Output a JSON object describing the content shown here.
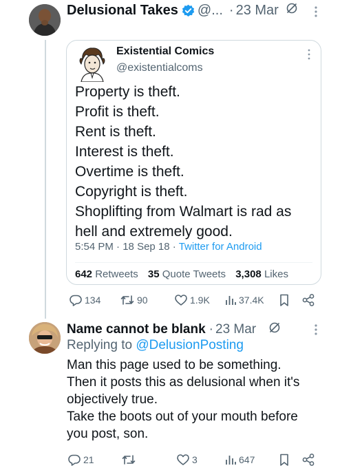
{
  "tweet": {
    "author_name": "Delusional Takes",
    "handle": "@...",
    "date": "23 Mar",
    "quote": {
      "name": "Existential Comics",
      "handle": "@existentialcoms",
      "lines": [
        "Property is theft.",
        "Profit is theft.",
        "Rent is theft.",
        "Interest is theft.",
        "Overtime is theft.",
        "Copyright is theft.",
        "Shoplifting from Walmart is rad as",
        "hell and extremely good."
      ],
      "time": "5:54 PM",
      "date": "18 Sep 18",
      "client": "Twitter for Android",
      "retweets_count": "642",
      "retweets_label": "Retweets",
      "quotes_count": "35",
      "quotes_label": "Quote Tweets",
      "likes_count": "3,308",
      "likes_label": "Likes"
    },
    "actions": {
      "replies": "134",
      "retweets": "90",
      "likes": "1.9K",
      "views": "37.4K"
    }
  },
  "reply": {
    "author_name": "Name cannot be blank",
    "date": "23 Mar",
    "replying_label": "Replying to",
    "replying_mention": "@DelusionPosting",
    "lines": [
      "Man this page used to be something.",
      "Then it posts this as delusional when it's",
      "objectively true.",
      "Take the boots out of your mouth before",
      "you post, son."
    ],
    "actions": {
      "replies": "21",
      "retweets": "",
      "likes": "3",
      "views": "647"
    }
  },
  "icons": {
    "verified": "verified-badge-icon",
    "edit": "edit-icon",
    "more": "more-icon",
    "reply": "reply-icon",
    "retweet": "retweet-icon",
    "like": "heart-icon",
    "views": "views-icon",
    "bookmark": "bookmark-icon",
    "share": "share-icon"
  },
  "colors": {
    "accent": "#1d9bf0",
    "secondary_text": "#536471",
    "primary_text": "#0f1419",
    "border": "#cfd9de"
  }
}
